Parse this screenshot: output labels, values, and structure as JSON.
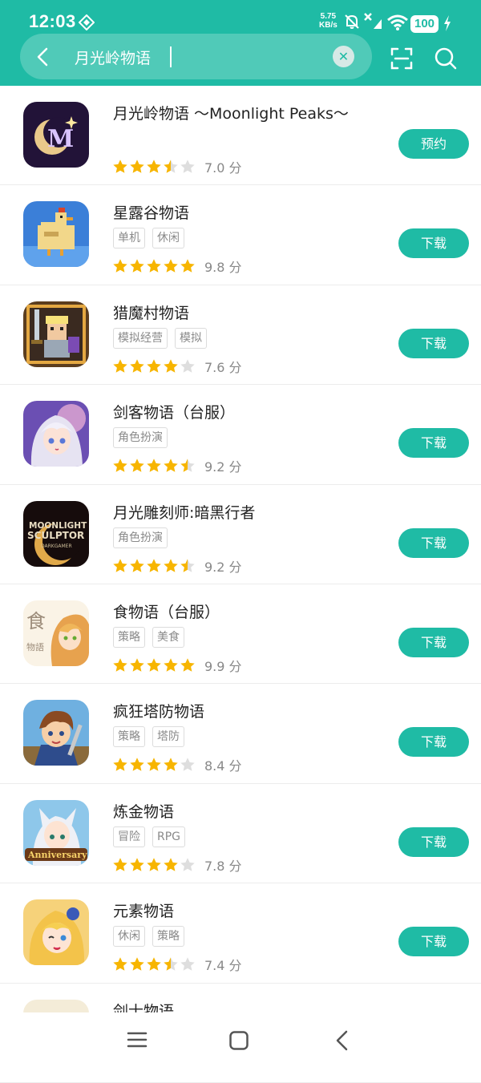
{
  "status_bar": {
    "time": "12:03",
    "net_speed_value": "5.75",
    "net_speed_unit": "KB/s",
    "battery": "100"
  },
  "search": {
    "query": "月光岭物语"
  },
  "colors": {
    "accent": "#1fbba5",
    "star_filled": "#f7b500",
    "star_empty": "#dedede"
  },
  "results": [
    {
      "name": "月光岭物语 ～Moonlight Peaks～",
      "tags": [],
      "rating": 3.5,
      "score": "7.0 分",
      "action": "预约",
      "icon": "moonlight-peaks-icon"
    },
    {
      "name": "星露谷物语",
      "tags": [
        "单机",
        "休闲"
      ],
      "rating": 5,
      "score": "9.8 分",
      "action": "下载",
      "icon": "stardew-chicken-icon"
    },
    {
      "name": "猎魔村物语",
      "tags": [
        "模拟经营",
        "模拟"
      ],
      "rating": 4,
      "score": "7.6 分",
      "action": "下载",
      "icon": "pixel-knight-icon"
    },
    {
      "name": "剑客物语（台服）",
      "tags": [
        "角色扮演"
      ],
      "rating": 4.5,
      "score": "9.2 分",
      "action": "下载",
      "icon": "anime-girl-icon"
    },
    {
      "name": "月光雕刻师:暗黑行者",
      "tags": [
        "角色扮演"
      ],
      "rating": 4.5,
      "score": "9.2 分",
      "action": "下载",
      "icon": "moonlight-sculptor-icon"
    },
    {
      "name": "食物语（台服）",
      "tags": [
        "策略",
        "美食"
      ],
      "rating": 5,
      "score": "9.9 分",
      "action": "下载",
      "icon": "food-fantasy-icon"
    },
    {
      "name": "疯狂塔防物语",
      "tags": [
        "策略",
        "塔防"
      ],
      "rating": 4,
      "score": "8.4 分",
      "action": "下载",
      "icon": "tower-defense-hero-icon"
    },
    {
      "name": "炼金物语",
      "tags": [
        "冒险",
        "RPG"
      ],
      "rating": 4,
      "score": "7.8 分",
      "action": "下载",
      "icon": "alchemy-anniversary-icon"
    },
    {
      "name": "元素物语",
      "tags": [
        "休闲",
        "策略"
      ],
      "rating": 3.5,
      "score": "7.4 分",
      "action": "下载",
      "icon": "element-girl-icon"
    },
    {
      "name": "剑士物语",
      "tags": [],
      "rating": null,
      "score": "",
      "action": "",
      "icon": "swordsman-icon"
    }
  ]
}
